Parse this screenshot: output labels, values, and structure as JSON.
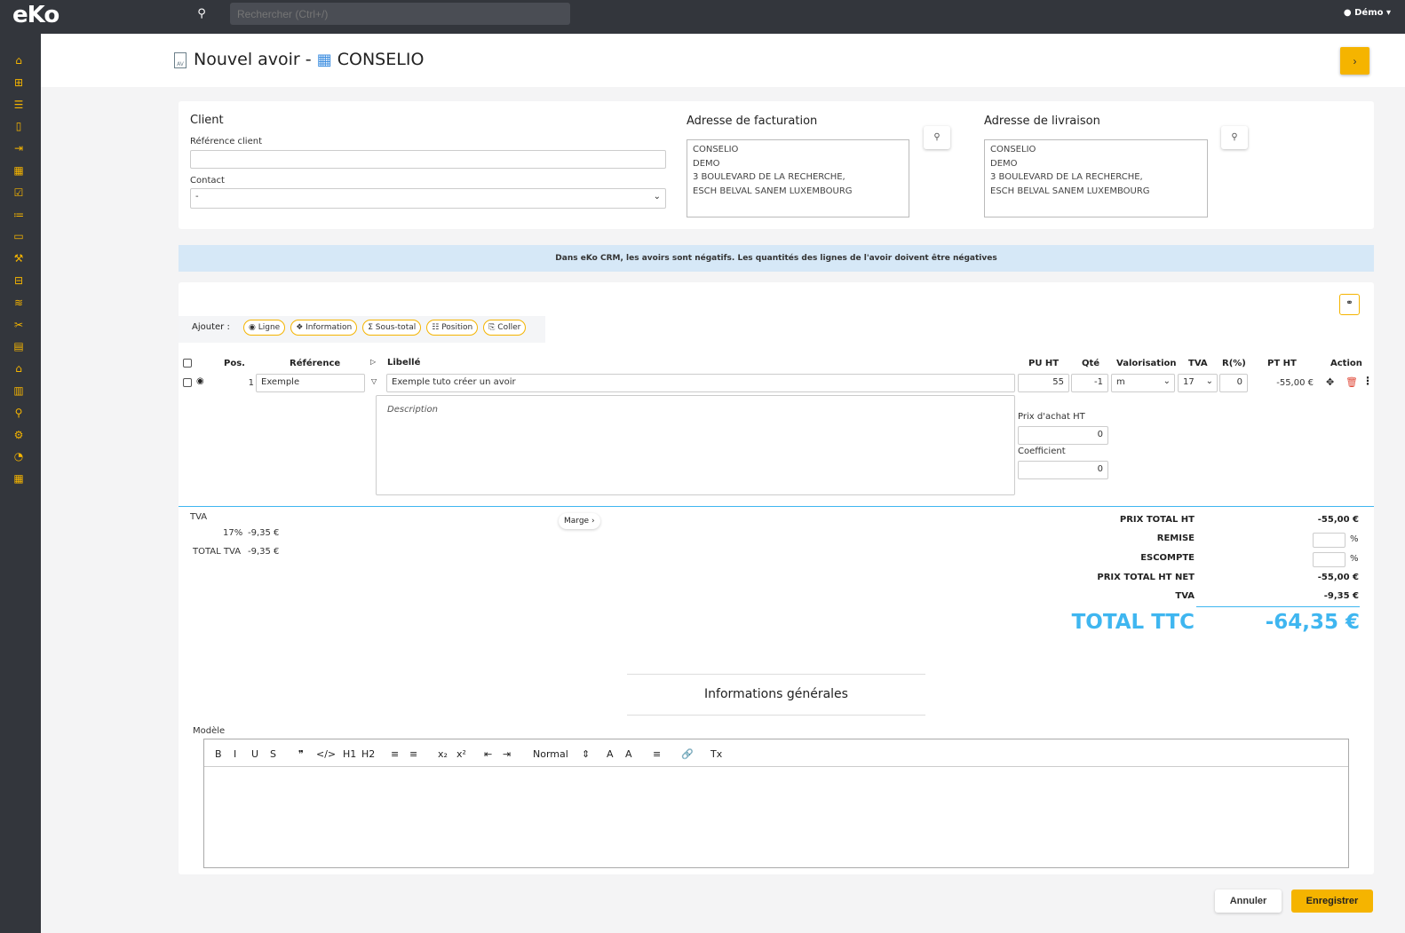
{
  "topbar": {
    "logo": "eKo",
    "search_placeholder": "Rechercher (Ctrl+/)",
    "user": "Démo"
  },
  "sidebar": {
    "icons": [
      "home-icon",
      "plus-square-icon",
      "list-icon",
      "file-icon",
      "file-export-icon",
      "calendar-icon",
      "calendar-check-icon",
      "tasks-icon",
      "folder-open-icon",
      "tools-icon",
      "sitemap-icon",
      "layers-icon",
      "wrench-icon",
      "book-icon",
      "boxes-icon",
      "chart-bar-icon",
      "search-icon",
      "cogs-icon",
      "chart-pie-icon",
      "calculator-icon"
    ]
  },
  "header": {
    "title": "Nouvel avoir -",
    "client_name": "CONSELIO",
    "av_badge": "AV"
  },
  "client": {
    "heading": "Client",
    "ref_label": "Référence client",
    "ref_value": "",
    "contact_label": "Contact",
    "contact_value": "-"
  },
  "billing": {
    "heading": "Adresse de facturation",
    "lines": [
      "CONSELIO",
      "DEMO",
      "3 BOULEVARD DE LA RECHERCHE,",
      "ESCH BELVAL SANEM LUXEMBOURG"
    ]
  },
  "delivery": {
    "heading": "Adresse de livraison",
    "lines": [
      "CONSELIO",
      "DEMO",
      "3 BOULEVARD DE LA RECHERCHE,",
      "ESCH BELVAL SANEM LUXEMBOURG"
    ]
  },
  "notice": "Dans eKo CRM, les avoirs sont négatifs. Les quantités des lignes de l'avoir doivent être négatives",
  "add": {
    "label": "Ajouter :",
    "buttons": [
      "Ligne",
      "Information",
      "Sous-total",
      "Position",
      "Coller"
    ]
  },
  "columns": {
    "pos": "Pos.",
    "ref": "Référence",
    "libelle": "Libellé",
    "pu": "PU HT",
    "qte": "Qté",
    "valo": "Valorisation",
    "tva": "TVA",
    "r": "R(%)",
    "pt": "PT HT",
    "action": "Action"
  },
  "line": {
    "pos": "1",
    "ref": "Exemple",
    "libelle": "Exemple tuto créer un avoir",
    "pu": "55",
    "qte": "-1",
    "valo": "m",
    "tva": "17",
    "r": "0",
    "pt": "-55,00 €",
    "description_placeholder": "Description",
    "achat_label": "Prix d'achat HT",
    "achat": "0",
    "coef_label": "Coefficient",
    "coef": "0"
  },
  "tva_summary": {
    "label": "TVA",
    "rate": "17%",
    "amount": "-9,35 €",
    "total_label": "TOTAL TVA",
    "total": "-9,35 €"
  },
  "marge": "Marge",
  "totals": {
    "prix_total_ht_label": "PRIX TOTAL HT",
    "prix_total_ht": "-55,00 €",
    "remise_label": "REMISE",
    "escompte_label": "ESCOMPTE",
    "pct": "%",
    "net_label": "PRIX TOTAL HT NET",
    "net": "-55,00 €",
    "tva_label": "TVA",
    "tva": "-9,35 €",
    "ttc_label": "TOTAL TTC",
    "ttc": "-64,35 €"
  },
  "general": {
    "heading": "Informations générales",
    "modele_label": "Modèle",
    "format": "Normal"
  },
  "footer": {
    "cancel": "Annuler",
    "save": "Enregistrer"
  },
  "colors": {
    "accent": "#f5b400",
    "total": "#3fb6f0",
    "dark": "#33363c"
  }
}
